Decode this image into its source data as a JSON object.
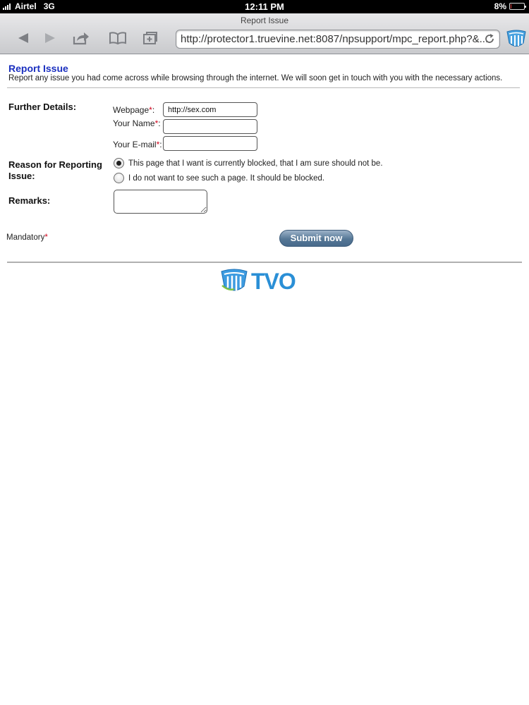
{
  "status_bar": {
    "carrier": "Airtel",
    "network": "3G",
    "time": "12:11 PM",
    "battery": "8%",
    "battery_level": 0.08
  },
  "browser": {
    "page_title": "Report Issue",
    "url": "http://protector1.truevine.net:8087/npsupport/mpc_report.php?&...",
    "icons": [
      "back-icon",
      "forward-icon",
      "share-icon",
      "bookmarks-icon",
      "add-bookmark-icon",
      "reload-icon",
      "extension-icon"
    ]
  },
  "page": {
    "heading": "Report Issue",
    "description": "Report any issue you had come across while browsing through the internet. We will soon get in touch with you with the necessary actions.",
    "further_details_label": "Further Details:",
    "fields": {
      "webpage_label": "Webpage",
      "webpage_value": "http://sex.com",
      "name_label": "Your Name",
      "name_value": "",
      "email_label": "Your E-mail",
      "email_value": ""
    },
    "required_mark": "*",
    "colon": ":",
    "reason_label_line1": "Reason for Reporting",
    "reason_label_line2": "Issue:",
    "reasons": [
      {
        "label": "This page that I want is currently blocked, that I am sure should not be.",
        "checked": true
      },
      {
        "label": "I do not want to see such a page. It should be blocked.",
        "checked": false
      }
    ],
    "remarks_label": "Remarks:",
    "remarks_value": "",
    "mandatory_label": "Mandatory",
    "submit_label": "Submit now",
    "logo_text": "TVO"
  },
  "colors": {
    "heading": "#1a2fbf",
    "required": "#d0021b",
    "button": "#557796",
    "logo": "#2a8fd6"
  }
}
